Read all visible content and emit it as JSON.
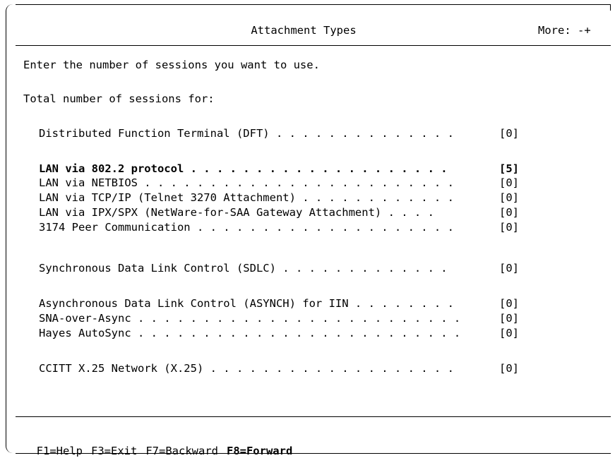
{
  "header": {
    "title": "Attachment Types",
    "more": "More: -+"
  },
  "body": {
    "instruction": "Enter the number of sessions you want to use.",
    "total_label": "Total number of sessions for:"
  },
  "sessions": [
    {
      "label": "Distributed Function Terminal (DFT) . . . . . . . . . . . . . .",
      "value": "[0]",
      "bold": false
    },
    {
      "label": "LAN via 802.2 protocol . . . . . . . . . . . . . . . . . . . .",
      "value": "[5]",
      "bold": true
    },
    {
      "label": "LAN via NETBIOS . . . . . . . . . . . . . . . . . . . . . . . .",
      "value": "[0]",
      "bold": false
    },
    {
      "label": "LAN via TCP/IP (Telnet 3270 Attachment) . . . . . . . . . . . .",
      "value": "[0]",
      "bold": false
    },
    {
      "label": "LAN via IPX/SPX (NetWare-for-SAA Gateway Attachment) . . . .",
      "value": "[0]",
      "bold": false
    },
    {
      "label": "3174 Peer Communication . . . . . . . . . . . . . . . . . . . .",
      "value": "[0]",
      "bold": false
    },
    {
      "label": "Synchronous Data Link Control (SDLC) . . . . . . . . . . . . .",
      "value": "[0]",
      "bold": false
    },
    {
      "label": "Asynchronous Data Link Control (ASYNCH) for IIN . . . . . . . .",
      "value": "[0]",
      "bold": false
    },
    {
      "label": "SNA-over-Async . . . . . . . . . . . . . . . . . . . . . . . . .",
      "value": "[0]",
      "bold": false
    },
    {
      "label": "Hayes AutoSync . . . . . . . . . . . . . . . . . . . . . . . . .",
      "value": "[0]",
      "bold": false
    },
    {
      "label": "CCITT X.25 Network (X.25) . . . . . . . . . . . . . . . . . . .",
      "value": "[0]",
      "bold": false
    }
  ],
  "fkeys": {
    "help": "F1=Help",
    "exit": "F3=Exit",
    "backward": "F7=Backward",
    "forward": "F8=Forward"
  }
}
